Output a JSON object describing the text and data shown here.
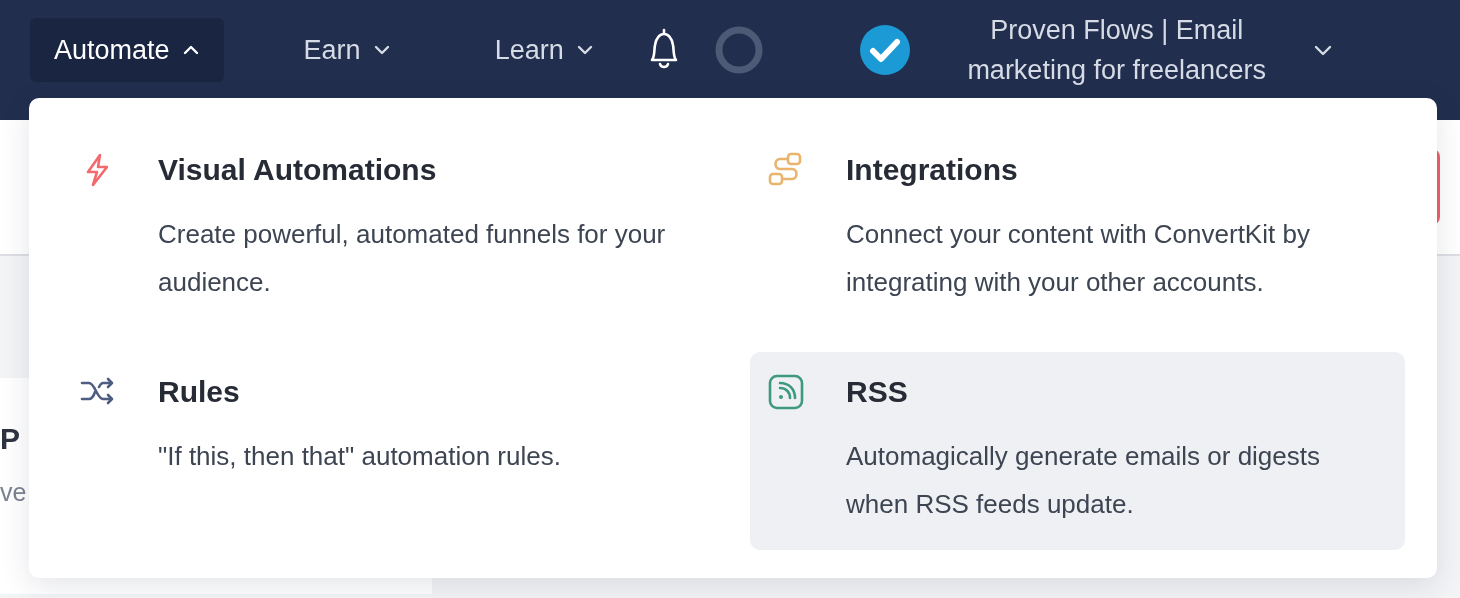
{
  "nav": {
    "items": [
      {
        "label": "Automate",
        "expanded": true
      },
      {
        "label": "Earn",
        "expanded": false
      },
      {
        "label": "Learn",
        "expanded": false
      }
    ],
    "account": {
      "name": "Proven Flows | Email marketing for freelancers"
    }
  },
  "page": {
    "card": {
      "title": "P",
      "subtitle": "ve"
    }
  },
  "menu": {
    "items": [
      {
        "kind": "bolt",
        "title": "Visual Automations",
        "description": "Create powerful, automated funnels for your audience.",
        "selected": false
      },
      {
        "kind": "cable",
        "title": "Integrations",
        "description": "Connect your content with ConvertKit by integrating with your other accounts.",
        "selected": false
      },
      {
        "kind": "shuffle",
        "title": "Rules",
        "description": "\"If this, then that\" automation rules.",
        "selected": false
      },
      {
        "kind": "rss",
        "title": "RSS",
        "description": "Automagically generate emails or digests when RSS feeds update.",
        "selected": true
      }
    ]
  }
}
